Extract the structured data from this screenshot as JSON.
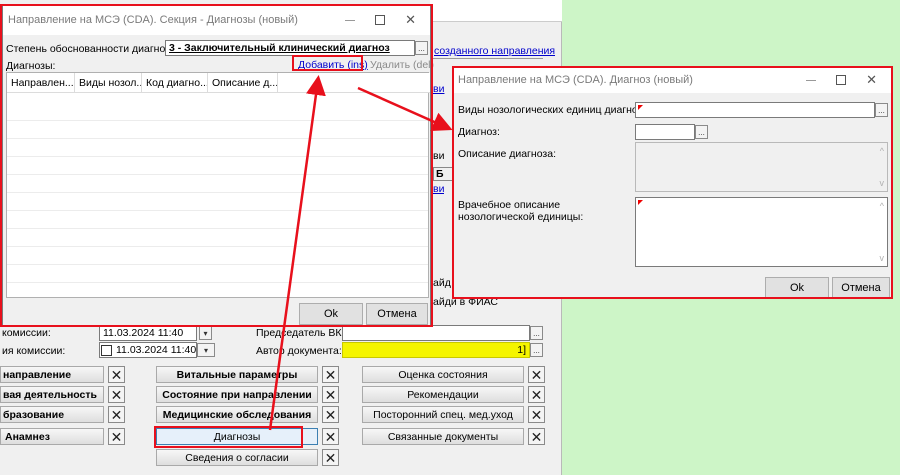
{
  "main_form": {
    "frag_link_top": "созданного направления",
    "frag_vi": "ви",
    "frag_vi2": "ви",
    "frag_vi3": "ви",
    "frag_b": "Б",
    "frag_ai": "айд",
    "frag_ai2": "айди в ФИАС",
    "label_commission": "комиссии:",
    "label_commission2": "ия комиссии:",
    "date_value_1": "11.03.2024 11:40",
    "date_value_2": "11.03.2024 11:40",
    "label_chair": "Председатель ВК:",
    "label_author": "Автор документа:",
    "author_value_suffix": "1]",
    "ellipsis": "...",
    "dropdown_glyph": "▾",
    "left_buttons": [
      "направление",
      "вая деятельность",
      "бразование",
      "Анамнез"
    ],
    "center_buttons": [
      "Витальные параметры",
      "Состояние при направлении",
      "Медицинские обследования",
      "Диагнозы",
      "Сведения о согласии"
    ],
    "right_buttons": [
      "Оценка состояния",
      "Рекомендации",
      "Посторонний спец. мед.уход",
      "Связанные документы"
    ],
    "close_glyph": "✕"
  },
  "section_dialog": {
    "title": "Направление на МСЭ (CDA). Секция - Диагнозы (новый)",
    "degree_label": "Степень обоснованности диагноза:",
    "degree_value": "3 - Заключительный клинический диагноз",
    "diagnoses_label": "Диагнозы:",
    "add_link": "Добавить (ins)",
    "delete_link": "Удалить (del)",
    "columns": [
      "Направлен...",
      "Виды нозол...",
      "Код диагно...",
      "Описание д..."
    ],
    "ok": "Ok",
    "cancel": "Отмена",
    "close_glyph": "✕"
  },
  "diagnosis_dialog": {
    "title": "Направление на МСЭ (CDA). Диагноз (новый)",
    "nosology_label": "Виды нозологических единиц диагноза:",
    "diagnosis_label": "Диагноз:",
    "description_label": "Описание диагноза:",
    "doctor_description_label": "Врачебное описание нозологической единицы:",
    "ok": "Ok",
    "cancel": "Отмена",
    "close_glyph": "✕",
    "scroll_up": "^",
    "scroll_down": "v"
  },
  "colors": {
    "highlight": "#e8101c",
    "link": "#0000cc",
    "yellow": "#f5f500",
    "background": "#cdf5c7"
  }
}
